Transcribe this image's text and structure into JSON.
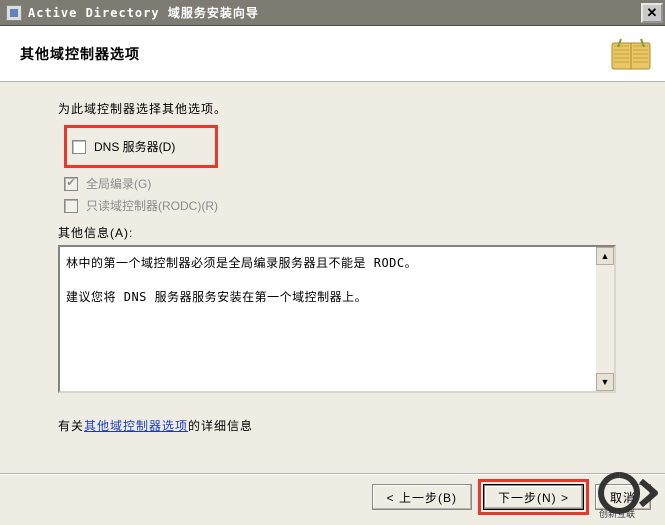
{
  "title": "Active Directory 域服务安装向导",
  "header": {
    "title": "其他域控制器选项"
  },
  "intro": "为此域控制器选择其他选项。",
  "options": {
    "dns": {
      "label": "DNS 服务器(D)",
      "checked": false,
      "enabled": true
    },
    "gc": {
      "label": "全局编录(G)",
      "checked": true,
      "enabled": false
    },
    "rodc": {
      "label": "只读域控制器(RODC)(R)",
      "checked": false,
      "enabled": false
    }
  },
  "info_label": "其他信息(A):",
  "info_text_line1": "林中的第一个域控制器必须是全局编录服务器且不能是 RODC。",
  "info_text_line2": "建议您将 DNS 服务器服务安装在第一个域控制器上。",
  "more": {
    "prefix": "有关",
    "link": "其他域控制器选项",
    "suffix": "的详细信息"
  },
  "buttons": {
    "back": "< 上一步(B)",
    "next": "下一步(N) >",
    "cancel": "取消"
  },
  "close_glyph": "✕",
  "scroll_up": "▲",
  "scroll_down": "▼",
  "check_glyph": "✔",
  "watermark": "创新互联"
}
